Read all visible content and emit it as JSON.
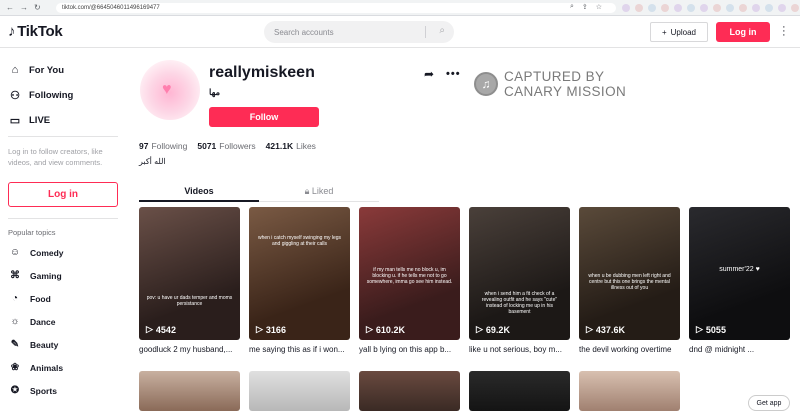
{
  "browser": {
    "url": "tiktok.com/@6645046011496169477"
  },
  "header": {
    "brand": "TikTok",
    "search_placeholder": "Search accounts",
    "upload_label": "Upload",
    "login_label": "Log in"
  },
  "sidebar": {
    "nav": [
      {
        "label": "For You",
        "icon": "home-icon"
      },
      {
        "label": "Following",
        "icon": "users-icon"
      },
      {
        "label": "LIVE",
        "icon": "live-icon"
      }
    ],
    "login_prompt": "Log in to follow creators, like videos, and view comments.",
    "login_button": "Log in",
    "topics_heading": "Popular topics",
    "topics": [
      {
        "label": "Comedy",
        "icon": "comedy-icon"
      },
      {
        "label": "Gaming",
        "icon": "gaming-icon"
      },
      {
        "label": "Food",
        "icon": "food-icon"
      },
      {
        "label": "Dance",
        "icon": "dance-icon"
      },
      {
        "label": "Beauty",
        "icon": "beauty-icon"
      },
      {
        "label": "Animals",
        "icon": "animals-icon"
      },
      {
        "label": "Sports",
        "icon": "sports-icon"
      }
    ]
  },
  "profile": {
    "username": "reallymiskeen",
    "nickname": "مها",
    "follow_label": "Follow",
    "following_count": "97",
    "following_label": "Following",
    "followers_count": "5071",
    "followers_label": "Followers",
    "likes_count": "421.1K",
    "likes_label": "Likes",
    "bio": "الله أكبر"
  },
  "watermark": {
    "line1": "CAPTURED BY",
    "line2": "CANARY MISSION"
  },
  "tabs": {
    "videos": "Videos",
    "liked": "Liked"
  },
  "videos": [
    {
      "views": "4542",
      "title": "goodluck 2 my husband,...",
      "caption": "pov: u have ur dads temper and moms persistance",
      "bg": "#3a2a26"
    },
    {
      "views": "3166",
      "title": "me saying this as if i won...",
      "caption": "when i catch myself swinging my legs and giggling at their calls",
      "bg": "#4a3024"
    },
    {
      "views": "610.2K",
      "title": "yall b lying on this app b...",
      "caption": "if my man tells me no block u, im blocking u. if he tells me not to go somewhere, imma go see him instead.",
      "bg": "#5a2a28"
    },
    {
      "views": "69.2K",
      "title": "like u not serious, boy m...",
      "caption": "when i send him a fit check of a revealing outfit and he says \"cute\" instead of locking me up in his basement",
      "bg": "#2a2624"
    },
    {
      "views": "437.6K",
      "title": "the devil working overtime",
      "caption": "when u be dubbing men left right and centre but this one brings the mental illness out of you",
      "bg": "#332a22"
    },
    {
      "views": "5055",
      "title": "dnd @ midnight ...",
      "caption": "summer'22 ♥",
      "bg": "#1a1a1c"
    }
  ],
  "get_app": "Get app"
}
